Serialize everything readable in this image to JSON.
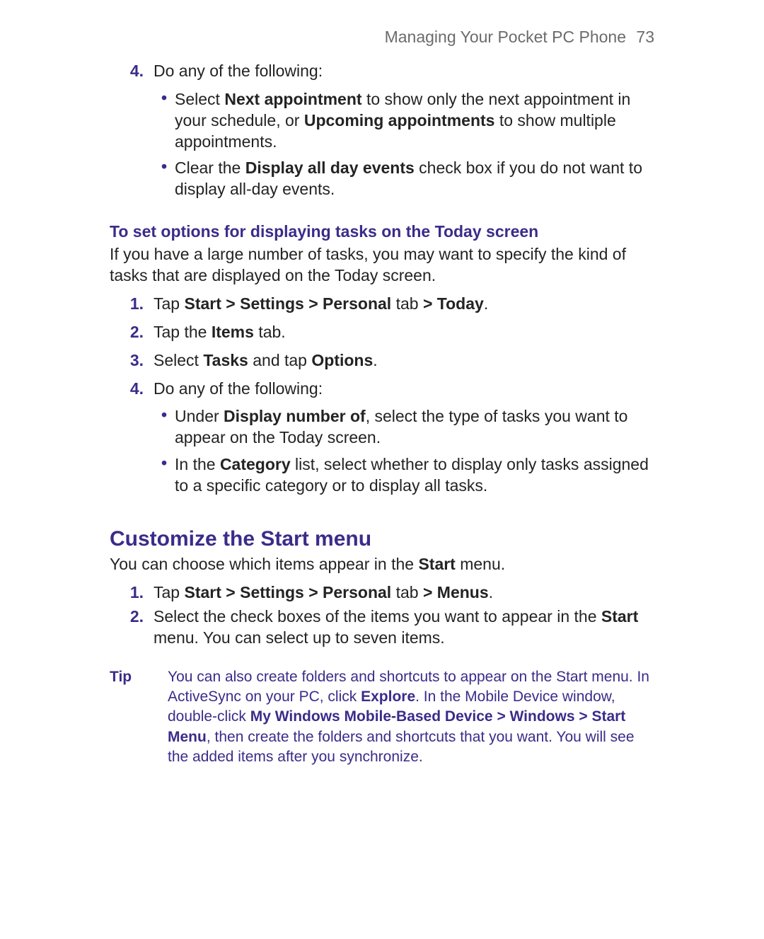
{
  "header": {
    "chapter": "Managing Your Pocket PC Phone",
    "page": "73"
  },
  "ol_top": {
    "n4": {
      "num": "4.",
      "text": "Do any of the following:"
    }
  },
  "bul_top": {
    "b1": {
      "pre": "Select ",
      "bold1": "Next appointment",
      "mid": " to show only the next appointment in your schedule, or ",
      "bold2": "Upcoming appointments",
      "post": " to show multiple appointments."
    },
    "b2": {
      "pre": "Clear the ",
      "bold1": "Display all day events",
      "post": " check box if you do not want to display all-day events."
    }
  },
  "tasks_heading": "To set options for displaying tasks on the Today screen",
  "tasks_intro": "If you have a large number of tasks, you may want to specify the kind of tasks that are displayed on the Today screen.",
  "tasks_steps": {
    "s1": {
      "num": "1.",
      "pre": "Tap ",
      "bold1": "Start > Settings > Personal",
      "mid": " tab ",
      "bold2": "> Today",
      "post": "."
    },
    "s2": {
      "num": "2.",
      "pre": "Tap the ",
      "bold1": "Items",
      "post": " tab."
    },
    "s3": {
      "num": "3.",
      "pre": "Select ",
      "bold1": "Tasks",
      "mid": " and tap ",
      "bold2": "Options",
      "post": "."
    },
    "s4": {
      "num": "4.",
      "text": "Do any of the following:"
    }
  },
  "tasks_bullets": {
    "b1": {
      "pre": "Under ",
      "bold1": "Display number of",
      "post": ", select the type of tasks you want to appear on the Today screen."
    },
    "b2": {
      "pre": "In the ",
      "bold1": "Category",
      "post": " list, select whether to display only tasks assigned to a specific category or to display all tasks."
    }
  },
  "start_menu_heading": "Customize the Start menu",
  "start_menu_intro": {
    "pre": "You can choose which items appear in the ",
    "bold1": "Start",
    "post": " menu."
  },
  "start_menu_steps": {
    "s1": {
      "num": "1.",
      "pre": "Tap ",
      "bold1": "Start > Settings > Personal",
      "mid": " tab ",
      "bold2": "> Menus",
      "post": "."
    },
    "s2": {
      "num": "2.",
      "pre": "Select the check boxes of the items you want to appear in the ",
      "bold1": "Start",
      "post": " menu. You can select up to seven items."
    }
  },
  "tip": {
    "label": "Tip",
    "pre": "You can also create folders and shortcuts to appear on the Start menu. In ActiveSync on your PC, click ",
    "bold1": "Explore",
    "mid": ". In the Mobile Device window, double-click ",
    "bold2": "My Windows Mobile-Based Device > Windows > Start Menu",
    "post": ", then create the folders and shortcuts that you want. You will see the added items after you synchronize."
  }
}
